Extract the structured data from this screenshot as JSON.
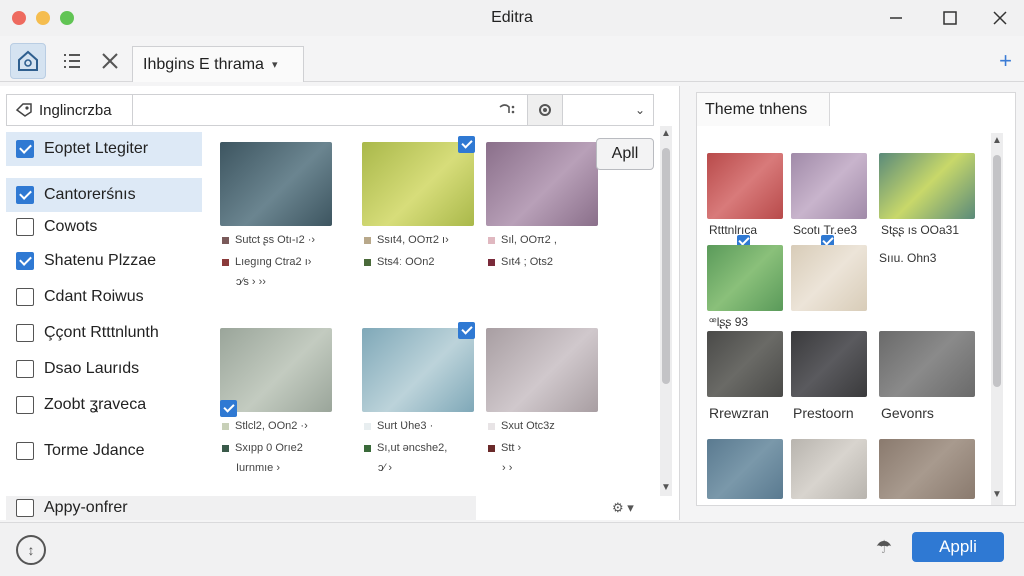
{
  "window": {
    "title": "Editra"
  },
  "colors": {
    "accent": "#2f79d3",
    "close": "#ee6a5f",
    "minimize": "#f5bd4f",
    "zoom": "#61c454"
  },
  "toolbar": {
    "tab_label": "Ihbgins E thrama",
    "home_icon": "home-icon",
    "list_icon": "list-icon",
    "tools_icon": "tools-icon",
    "add_icon": "plus-icon"
  },
  "filter": {
    "search_value": "Inglincrzba",
    "items": [
      {
        "label": "Eoptet Ltegiter",
        "checked": true,
        "selected": true
      },
      {
        "label": "Cantorerśnıs",
        "checked": true,
        "selected": true
      },
      {
        "label": "Cowots",
        "checked": false,
        "selected": false
      },
      {
        "label": "Shatenu Plzzae",
        "checked": true,
        "selected": false
      },
      {
        "label": "Cdant Roiwus",
        "checked": false,
        "selected": false
      },
      {
        "label": "Ççont Rtttnlunth",
        "checked": false,
        "selected": false
      },
      {
        "label": "Dsao Laurıds",
        "checked": false,
        "selected": false
      },
      {
        "label": "Zoobt ʓraveca",
        "checked": false,
        "selected": false
      },
      {
        "label": "Torme Jdance",
        "checked": false,
        "selected": false
      }
    ],
    "bottom_item": "Appy-onfrer"
  },
  "grid": {
    "apply_label": "Apll",
    "tiles": [
      {
        "c1": "#3d5560",
        "c2": "#6b8590",
        "checked": false,
        "meta": [
          "Sutct ʂs Otı-ı2  ·›",
          "Lıegıng Ctra2  ı›"
        ],
        "extra": "ɔ⁄s      ›   ››",
        "sw": [
          "#7a5a5a",
          "#8a3a3a"
        ]
      },
      {
        "c1": "#a9b84a",
        "c2": "#d7dd7a",
        "checked": true,
        "meta": [
          "Ssıt4, OOπ2  ı›",
          "Sts4ː OOn2"
        ],
        "extra": "",
        "sw": [
          "#b8a88a",
          "#4a6a3a"
        ]
      },
      {
        "c1": "#8a6f8a",
        "c2": "#b8a0b8",
        "checked": false,
        "meta": [
          "Sıl, OOπ2 ,",
          "Sıt4 ; Ots2"
        ],
        "extra": "",
        "sw": [
          "#e0b8c0",
          "#7a2a3a"
        ]
      },
      {
        "c1": "#9aa59a",
        "c2": "#c3cbc0",
        "checked": true,
        "meta": [
          "Stlcl2, OOn2  ·›",
          "Sxıpp 0 Orıe2"
        ],
        "extra": "Iurnmıe   ›",
        "sw": [
          "#c8d0b8",
          "#3a5a4a"
        ]
      },
      {
        "c1": "#7fa8b8",
        "c2": "#bcd3da",
        "checked": true,
        "meta": [
          "Surt Ʋhe3  ·",
          "Sı,ut əncshe2,"
        ],
        "extra": "ɔ⁄    ›",
        "sw": [
          "#e8eef0",
          "#3a6a3a"
        ]
      },
      {
        "c1": "#a89ea2",
        "c2": "#d0c8cc",
        "checked": false,
        "meta": [
          "Sxut Otc3z",
          "Stt    ›"
        ],
        "extra": "›      ›",
        "sw": [
          "#e8e4e6",
          "#6a2a2a"
        ]
      }
    ]
  },
  "themes": {
    "tab_label": "Theme tnhens",
    "tiles": [
      {
        "c1": "#b84a4a",
        "c2": "#d87a7a",
        "label": "Rtttnlrıca",
        "checked": true
      },
      {
        "c1": "#a08aa8",
        "c2": "#c8b4cc",
        "label": "Scotı Tr.ee3",
        "checked": true
      },
      {
        "c1": "#5a8a7a",
        "c2": "#c8d86a",
        "label": "Stʂʂ ıs OOa31",
        "checked": false
      },
      {
        "c1": "#5a9a5a",
        "c2": "#8ac07a",
        "label": "ꟹlʂʂ 93",
        "checked": false
      },
      {
        "c1": "#d8ccb8",
        "c2": "#ece4d8",
        "label": "",
        "checked": false
      },
      {
        "c1": "#e8e8e8",
        "c2": "#ffffff",
        "label": "Sııu. Ohn3",
        "checked": false
      },
      {
        "c1": "#4a4a48",
        "c2": "#6a6a66",
        "label": "Rrewzran",
        "checked": false
      },
      {
        "c1": "#3a3a3c",
        "c2": "#5a5a5e",
        "label": "Prestoorn",
        "checked": false
      },
      {
        "c1": "#6a6a6a",
        "c2": "#8a8a8a",
        "label": "Gevonrs",
        "checked": false
      },
      {
        "c1": "#5a7a90",
        "c2": "#7a98aa",
        "label": "",
        "checked": false
      },
      {
        "c1": "#b8b4ae",
        "c2": "#d8d4ce",
        "label": "",
        "checked": false
      },
      {
        "c1": "#8a7a6e",
        "c2": "#a89a8e",
        "label": "",
        "checked": false
      }
    ]
  },
  "footer": {
    "apply_label": "Appli",
    "help_icon": "info-icon",
    "cloud_icon": "cloud-icon"
  }
}
